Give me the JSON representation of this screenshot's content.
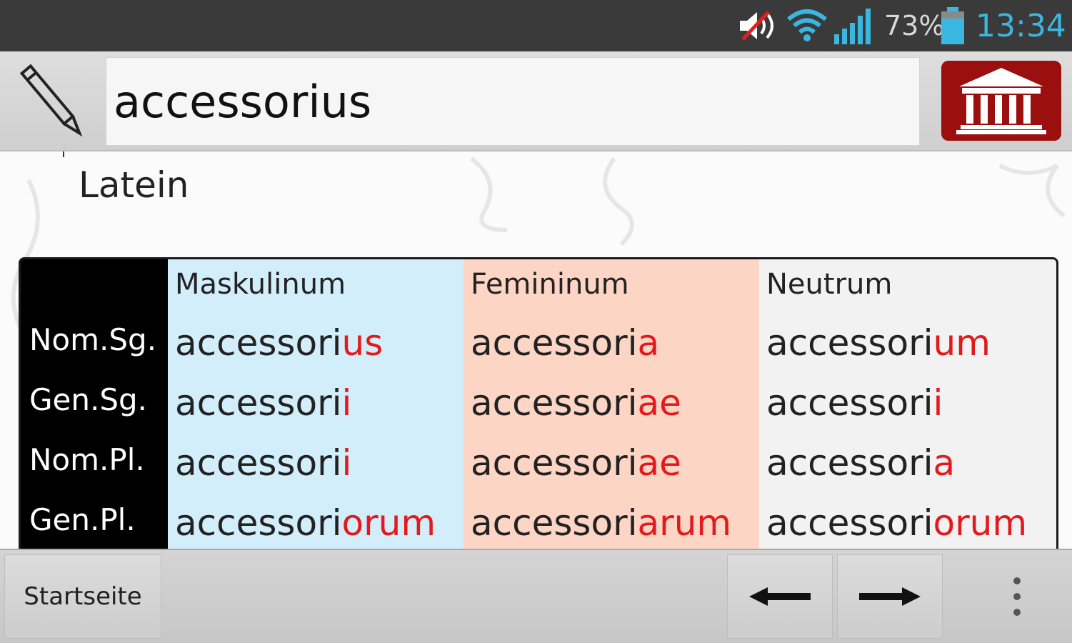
{
  "status_bar": {
    "battery_percent": "73%",
    "time": "13:34",
    "icons": [
      "volume-muted-icon",
      "wifi-icon",
      "signal-icon",
      "battery-icon"
    ],
    "time_color": "#3ab7e0"
  },
  "toolbar": {
    "edit_icon": "pencil-icon",
    "search_value": "accessorius",
    "dictionary_icon": "temple-icon",
    "accent_color": "#9c0f0f"
  },
  "content": {
    "language": "Latein",
    "table": {
      "columns": [
        "Maskulinum",
        "Femininum",
        "Neutrum"
      ],
      "rows": [
        {
          "label": "Nom.Sg.",
          "cells": [
            {
              "stem": "accessori",
              "ending": "us"
            },
            {
              "stem": "accessori",
              "ending": "a"
            },
            {
              "stem": "accessori",
              "ending": "um"
            }
          ]
        },
        {
          "label": "Gen.Sg.",
          "cells": [
            {
              "stem": "accessori",
              "ending": "i"
            },
            {
              "stem": "accessori",
              "ending": "ae"
            },
            {
              "stem": "accessori",
              "ending": "i"
            }
          ]
        },
        {
          "label": "Nom.Pl.",
          "cells": [
            {
              "stem": "accessori",
              "ending": "i"
            },
            {
              "stem": "accessori",
              "ending": "ae"
            },
            {
              "stem": "accessori",
              "ending": "a"
            }
          ]
        },
        {
          "label": "Gen.Pl.",
          "cells": [
            {
              "stem": "accessori",
              "ending": "orum"
            },
            {
              "stem": "accessori",
              "ending": "arum"
            },
            {
              "stem": "accessori",
              "ending": "orum"
            }
          ]
        }
      ],
      "colors": {
        "masc": "#d3eefb",
        "fem": "#fdd5c5",
        "neut": "#f2f2f2",
        "ending": "#e4191c"
      }
    }
  },
  "bottom_bar": {
    "home_label": "Startseite",
    "back_icon": "arrow-left-icon",
    "forward_icon": "arrow-right-icon",
    "menu_icon": "overflow-menu-icon"
  }
}
